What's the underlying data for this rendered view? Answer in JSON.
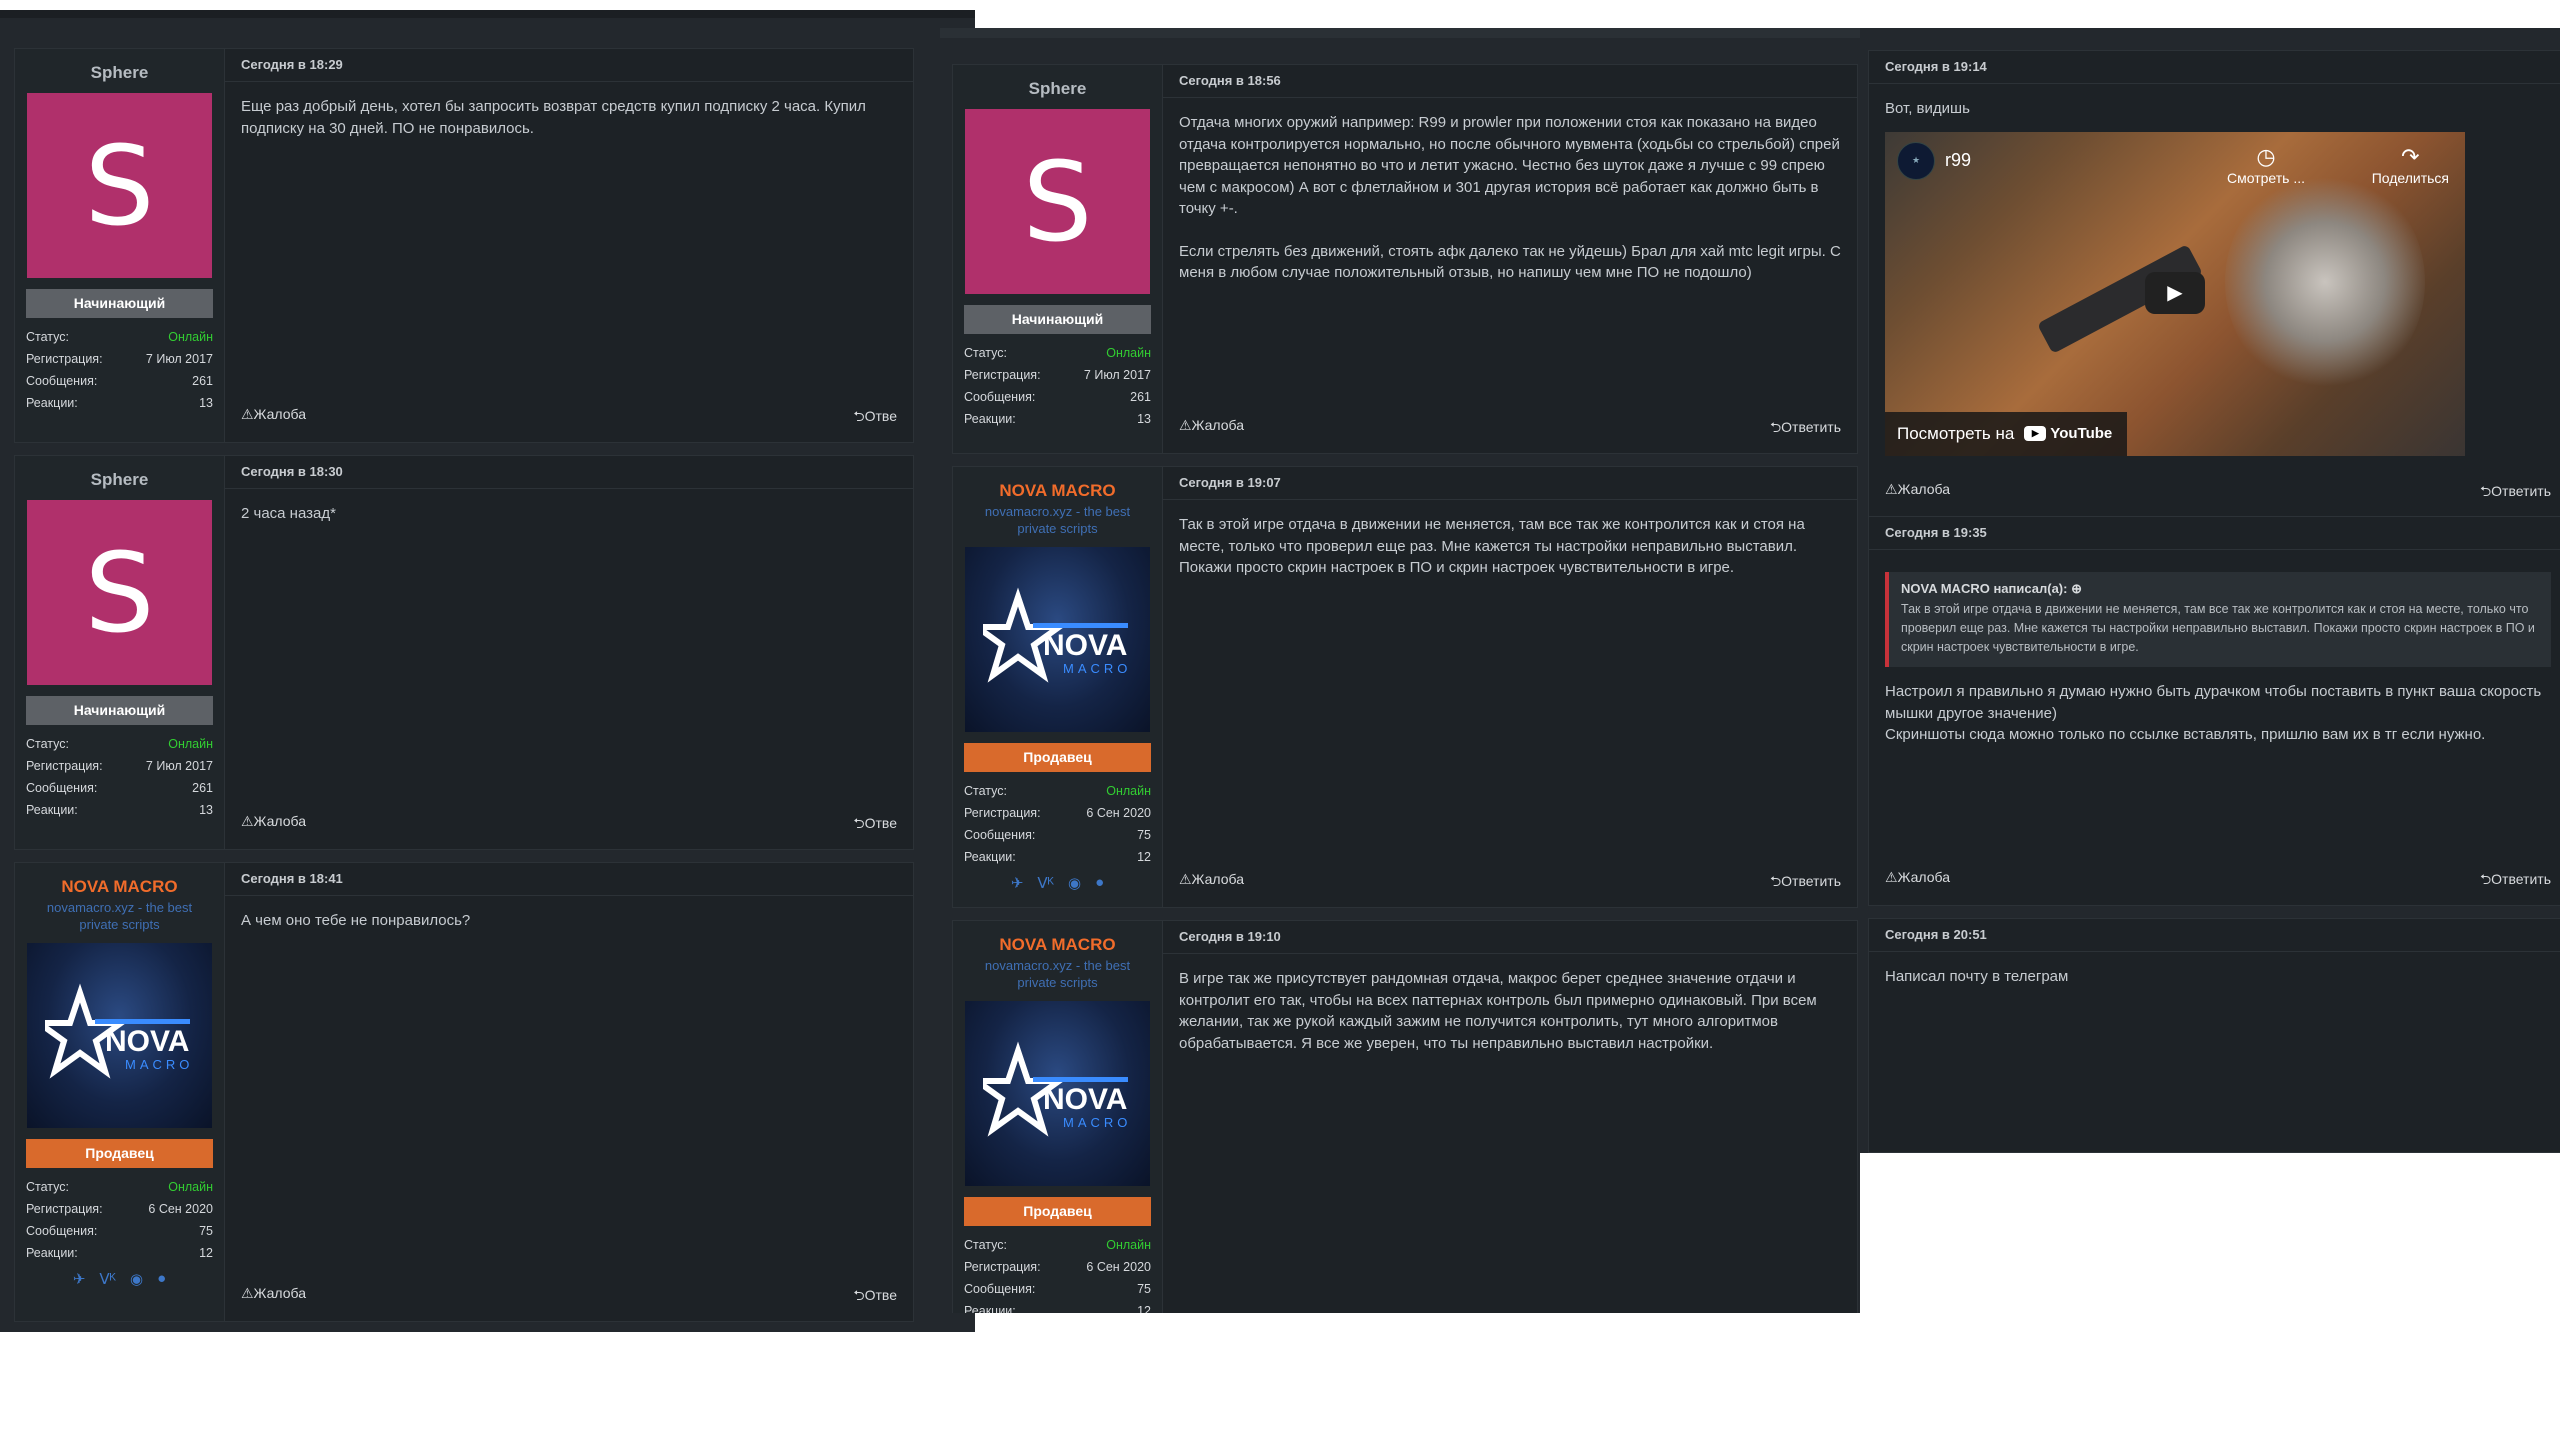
{
  "labels": {
    "status": "Статус:",
    "reg": "Регистрация:",
    "msgs": "Сообщения:",
    "reactions": "Реакции:",
    "report": "⚠Жалоба",
    "reply": "⮌Ответить",
    "reply_cut": "⮌Отве"
  },
  "users": {
    "sphere": {
      "name": "Sphere",
      "rank": "Начинающий",
      "status": "Онлайн",
      "reg": "7 Июл 2017",
      "msgs": "261",
      "reactions": "13",
      "avatar_letter": "S"
    },
    "nova": {
      "name": "NOVA MACRO",
      "title": "novamacro.xyz - the best private scripts",
      "rank": "Продавец",
      "status": "Онлайн",
      "reg": "6 Сен 2020",
      "msgs": "75",
      "reactions": "12",
      "logo_text": "NOVA",
      "logo_sub": "MACRO"
    }
  },
  "col1": {
    "p1": {
      "date": "Сегодня в 18:29",
      "text": "Еще раз добрый день, хотел бы запросить возврат средств купил подписку 2 часа. Купил подписку на 30 дней. ПО не понравилось."
    },
    "p2": {
      "date": "Сегодня в 18:30",
      "text": "2 часа назад*"
    },
    "p3": {
      "date": "Сегодня в 18:41",
      "text": "А чем оно тебе не понравилось?"
    }
  },
  "col2": {
    "p1": {
      "date": "Сегодня в 18:56",
      "text1": "Отдача многих оружий например: R99 и prowler при положении стоя как показано на видео отдача контролируется нормально, но после обычного мувмента (ходьбы со стрельбой) спрей превращается непонятно во что и летит ужасно. Честно без шуток даже я лучше с 99 спрею чем с макросом) А вот с флетлайном и 301 другая история всё работает как должно быть в точку +-.",
      "text2": "Если стрелять без движений, стоять афк далеко так не уйдешь) Брал для хай mtc legit игры. С меня в любом случае положительный отзыв, но напишу чем мне ПО не подошло)"
    },
    "p2": {
      "date": "Сегодня в 19:07",
      "text": "Так в этой игре отдача в движении не меняется, там все так же контролится как и стоя на месте, только что проверил еще раз. Мне кажется ты настройки неправильно выставил. Покажи просто скрин настроек в ПО и скрин настроек чувствительности в игре."
    },
    "p3": {
      "date": "Сегодня в 19:10",
      "text": "В игре так же присутствует рандомная отдача, макрос берет среднее значение отдачи и контролит его так, чтобы на всех паттернах контроль был примерно одинаковый. При всем желании, так же рукой каждый зажим не получится контролить, тут много алгоритмов обрабатывается. Я все же уверен, что ты неправильно выставил настройки."
    }
  },
  "col3": {
    "p1": {
      "date": "Сегодня в 19:14",
      "text": "Вот, видишь",
      "video": {
        "title": "r99",
        "watch": "Смотреть ...",
        "share": "Поделиться",
        "watch_on": "Посмотреть на",
        "youtube": "YouTube"
      }
    },
    "p2": {
      "date": "Сегодня в 19:35",
      "quote_author": "NOVA MACRO написал(а): ⊕",
      "quote_text": "Так в этой игре отдача в движении не меняется, там все так же контролится как и стоя на месте, только что проверил еще раз. Мне кажется ты настройки неправильно выставил. Покажи просто скрин настроек в ПО и скрин настроек чувствительности в игре.",
      "text1": "Настроил я правильно я думаю нужно быть дурачком чтобы поставить в пункт ваша скорость мышки другое значение)",
      "text2": "Скриншоты сюда можно только по ссылке вставлять, пришлю вам их в тг если нужно."
    },
    "p3": {
      "date": "Сегодня в 20:51",
      "text": "Написал почту в телеграм"
    }
  },
  "colors": {
    "bg": "#23282d",
    "sphere_avatar": "#b0306b",
    "seller": "#d96a2c",
    "online": "#32cd32",
    "nova_name": "#f16c2b"
  }
}
